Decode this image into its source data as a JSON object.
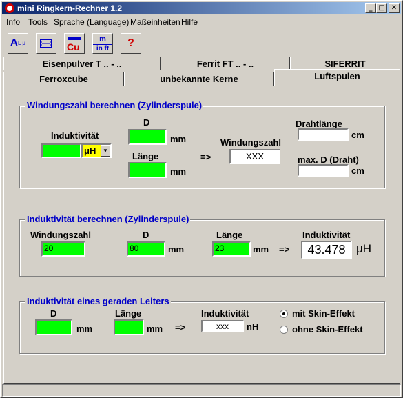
{
  "window": {
    "title": "mini Ringkern-Rechner 1.2",
    "btn_min": "_",
    "btn_max": "□",
    "btn_close": "✕"
  },
  "menu": {
    "info": "Info",
    "tools": "Tools",
    "language": "Sprache (Language)",
    "units": "Maßeinheiten",
    "help": "Hilfe"
  },
  "toolbar": {
    "ring_text": "A",
    "ring_sub": "L μ",
    "cu_label": "Cu",
    "units_top": "m",
    "units_bottom": "in ft",
    "help_label": "?"
  },
  "tabs": {
    "row1": [
      "Eisenpulver T .. - ..",
      "Ferrit FT .. - ..",
      "SIFERRIT"
    ],
    "row2": [
      "Ferroxcube",
      "unbekannte Kerne",
      "Luftspulen"
    ]
  },
  "group1": {
    "title": "Windungszahl berechnen (Zylinderspule)",
    "induct_label": "Induktivität",
    "induct_value": "",
    "unit_select": "μH",
    "d_label": "D",
    "d_value": "",
    "d_unit": "mm",
    "len_label": "Länge",
    "len_value": "",
    "len_unit": "mm",
    "arrow": "=>",
    "turns_label": "Windungszahl",
    "turns_value": "XXX",
    "wire_len_label": "Drahtlänge",
    "wire_len_value": "",
    "wire_len_unit": "cm",
    "maxd_label": "max. D (Draht)",
    "maxd_value": "",
    "maxd_unit": "cm"
  },
  "group2": {
    "title": "Induktivität berechnen (Zylinderspule)",
    "turns_label": "Windungszahl",
    "turns_value": "20",
    "d_label": "D",
    "d_value": "80",
    "d_unit": "mm",
    "len_label": "Länge",
    "len_value": "23",
    "len_unit": "mm",
    "arrow": "=>",
    "induct_label": "Induktivität",
    "induct_value": "43.478",
    "induct_unit": "μH"
  },
  "group3": {
    "title": "Induktivität eines geraden Leiters",
    "d_label": "D",
    "d_value": "",
    "d_unit": "mm",
    "len_label": "Länge",
    "len_value": "",
    "len_unit": "mm",
    "arrow": "=>",
    "induct_label": "Induktivität",
    "induct_value": "xxx",
    "induct_unit": "nH",
    "radio_skin": "mit Skin-Effekt",
    "radio_noskin": "ohne Skin-Effekt"
  },
  "colors": {
    "accent_blue": "#0000c8",
    "field_green": "#00ff00",
    "select_yellow": "#ffff00"
  }
}
